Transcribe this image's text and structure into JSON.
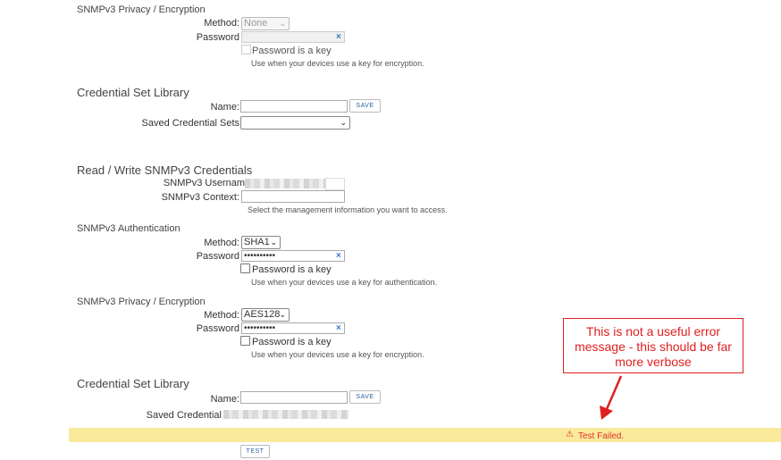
{
  "top_privacy": {
    "heading": "SNMPv3 Privacy / Encryption",
    "method_label": "Method:",
    "method_value": "None",
    "password_label": "Password",
    "key_checkbox_label": "Password is a key",
    "note": "Use when your devices use a key for encryption."
  },
  "library1": {
    "heading": "Credential Set Library",
    "name_label": "Name:",
    "save_label": "SAVE",
    "saved_label": "Saved Credential Sets"
  },
  "rw": {
    "heading": "Read / Write SNMPv3 Credentials",
    "username_label": "SNMPv3 Usernam",
    "context_label": "SNMPv3 Context:",
    "context_note": "Select the management information you want to access."
  },
  "auth": {
    "heading": "SNMPv3 Authentication",
    "method_label": "Method:",
    "method_value": "SHA1",
    "password_label": "Password",
    "password_value": "••••••••••",
    "key_checkbox_label": "Password is a key",
    "note": "Use when your devices use a key for authentication."
  },
  "privacy": {
    "heading": "SNMPv3 Privacy / Encryption",
    "method_label": "Method:",
    "method_value": "AES128",
    "password_label": "Password",
    "password_value": "••••••••••",
    "key_checkbox_label": "Password is a key",
    "note": "Use when your devices use a key for encryption."
  },
  "library2": {
    "heading": "Credential Set Library",
    "name_label": "Name:",
    "save_label": "SAVE",
    "saved_label": "Saved Credential"
  },
  "error_bar": {
    "message": "Test Failed.",
    "warning_icon": "⚠"
  },
  "test_label": "TEST",
  "annotation": {
    "text": "This is not a useful error message - this should be far more verbose",
    "color": "#e02020"
  },
  "colors": {
    "error_bar": "#faeb9c",
    "error_text": "#e0302a",
    "link": "#2a5f9e"
  }
}
